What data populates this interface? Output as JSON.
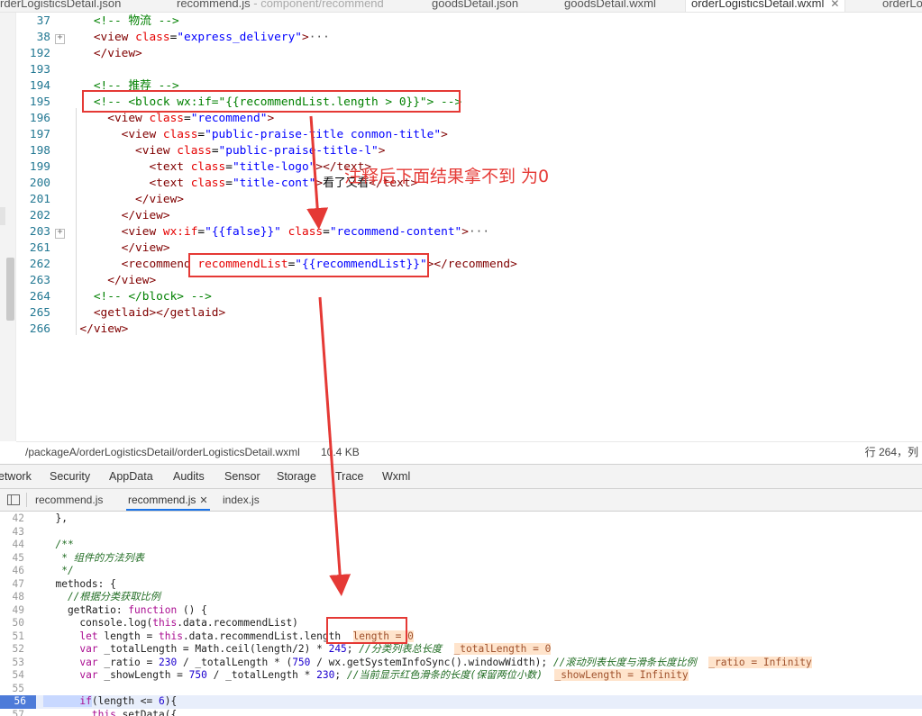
{
  "file_tabs": [
    {
      "label": "rderLogisticsDetail.json",
      "sub": ""
    },
    {
      "label": "recommend.js",
      "sub": " - component/recommend"
    },
    {
      "label": "goodsDetail.json",
      "sub": ""
    },
    {
      "label": "goodsDetail.wxml",
      "sub": ""
    },
    {
      "label": "orderLogisticsDetail.wxml",
      "sub": "",
      "close": "✕"
    },
    {
      "label": "orderLo",
      "sub": ""
    }
  ],
  "editor_lines": [
    {
      "num": "37",
      "fold": false,
      "tokens": [
        [
          "c-com",
          "<!-- 物流 -->"
        ]
      ],
      "indent": "    "
    },
    {
      "num": "38",
      "fold": true,
      "tokens": [
        [
          "c-tag",
          "<view "
        ],
        [
          "c-attr",
          "class"
        ],
        [
          "c-txt",
          "="
        ],
        [
          "c-str",
          "\"express_delivery\""
        ],
        [
          "c-tag",
          ">"
        ],
        [
          "c-ell",
          "···"
        ]
      ],
      "indent": "    "
    },
    {
      "num": "192",
      "fold": false,
      "tokens": [
        [
          "c-tag",
          "</view>"
        ]
      ],
      "indent": "    "
    },
    {
      "num": "193",
      "fold": false,
      "tokens": [],
      "indent": ""
    },
    {
      "num": "194",
      "fold": false,
      "tokens": [
        [
          "c-com",
          "<!-- 推荐 -->"
        ]
      ],
      "indent": "    "
    },
    {
      "num": "195",
      "fold": false,
      "tokens": [
        [
          "c-com",
          "<!-- <block wx:if=\"{{recommendList.length > 0}}\"> -->"
        ]
      ],
      "indent": "    "
    },
    {
      "num": "196",
      "fold": false,
      "tokens": [
        [
          "c-tag",
          "<view "
        ],
        [
          "c-attr",
          "class"
        ],
        [
          "c-txt",
          "="
        ],
        [
          "c-str",
          "\"recommend\""
        ],
        [
          "c-tag",
          ">"
        ]
      ],
      "indent": "      "
    },
    {
      "num": "197",
      "fold": false,
      "tokens": [
        [
          "c-tag",
          "<view "
        ],
        [
          "c-attr",
          "class"
        ],
        [
          "c-txt",
          "="
        ],
        [
          "c-str",
          "\"public-praise-title conmon-title\""
        ],
        [
          "c-tag",
          ">"
        ]
      ],
      "indent": "        "
    },
    {
      "num": "198",
      "fold": false,
      "tokens": [
        [
          "c-tag",
          "<view "
        ],
        [
          "c-attr",
          "class"
        ],
        [
          "c-txt",
          "="
        ],
        [
          "c-str",
          "\"public-praise-title-l\""
        ],
        [
          "c-tag",
          ">"
        ]
      ],
      "indent": "          "
    },
    {
      "num": "199",
      "fold": false,
      "tokens": [
        [
          "c-tag",
          "<text "
        ],
        [
          "c-attr",
          "class"
        ],
        [
          "c-txt",
          "="
        ],
        [
          "c-str",
          "\"title-logo\""
        ],
        [
          "c-tag",
          "></text>"
        ]
      ],
      "indent": "            "
    },
    {
      "num": "200",
      "fold": false,
      "tokens": [
        [
          "c-tag",
          "<text "
        ],
        [
          "c-attr",
          "class"
        ],
        [
          "c-txt",
          "="
        ],
        [
          "c-str",
          "\"title-cont\""
        ],
        [
          "c-tag",
          ">"
        ],
        [
          "c-txt",
          "看了又看"
        ],
        [
          "c-tag",
          "</text>"
        ]
      ],
      "indent": "            "
    },
    {
      "num": "201",
      "fold": false,
      "tokens": [
        [
          "c-tag",
          "</view>"
        ]
      ],
      "indent": "          "
    },
    {
      "num": "202",
      "fold": false,
      "tokens": [
        [
          "c-tag",
          "</view>"
        ]
      ],
      "indent": "        "
    },
    {
      "num": "203",
      "fold": true,
      "tokens": [
        [
          "c-tag",
          "<view "
        ],
        [
          "c-attr",
          "wx:if"
        ],
        [
          "c-txt",
          "="
        ],
        [
          "c-str",
          "\"{{false}}\""
        ],
        [
          "c-txt",
          " "
        ],
        [
          "c-attr",
          "class"
        ],
        [
          "c-txt",
          "="
        ],
        [
          "c-str",
          "\"recommend-content\""
        ],
        [
          "c-tag",
          ">"
        ],
        [
          "c-ell",
          "···"
        ]
      ],
      "indent": "        "
    },
    {
      "num": "261",
      "fold": false,
      "tokens": [
        [
          "c-tag",
          "</view>"
        ]
      ],
      "indent": "        "
    },
    {
      "num": "262",
      "fold": false,
      "tokens": [
        [
          "c-tag",
          "<recommend "
        ],
        [
          "c-attr",
          "recommendList"
        ],
        [
          "c-txt",
          "="
        ],
        [
          "c-str",
          "\"{{recommendList}}\""
        ],
        [
          "c-tag",
          "></recommend>"
        ]
      ],
      "indent": "        "
    },
    {
      "num": "263",
      "fold": false,
      "tokens": [
        [
          "c-tag",
          "</view>"
        ]
      ],
      "indent": "      "
    },
    {
      "num": "264",
      "fold": false,
      "tokens": [
        [
          "c-com",
          "<!-- </block> -->"
        ]
      ],
      "indent": "    "
    },
    {
      "num": "265",
      "fold": false,
      "tokens": [
        [
          "c-tag",
          "<getlaid></getlaid>"
        ]
      ],
      "indent": "    "
    },
    {
      "num": "266",
      "fold": false,
      "tokens": [
        [
          "c-tag",
          "</view>"
        ]
      ],
      "indent": "  "
    }
  ],
  "status_bar": {
    "path": "/packageA/orderLogisticsDetail/orderLogisticsDetail.wxml",
    "size": "10.4 KB",
    "position": "行 264，列"
  },
  "devtools_tabs": [
    "etwork",
    "Security",
    "AppData",
    "Audits",
    "Sensor",
    "Storage",
    "Trace",
    "Wxml"
  ],
  "source_tabs": [
    {
      "label": "recommend.js",
      "active": false
    },
    {
      "label": "recommend.js",
      "active": true,
      "close": "✕"
    },
    {
      "label": "index.js",
      "active": false
    }
  ],
  "source_lines": [
    {
      "num": "42",
      "tokens": [
        [
          "s-txt",
          "  },"
        ]
      ]
    },
    {
      "num": "43",
      "tokens": []
    },
    {
      "num": "44",
      "tokens": [
        [
          "s-com",
          "  /**"
        ]
      ]
    },
    {
      "num": "45",
      "tokens": [
        [
          "s-com",
          "   * 组件的方法列表"
        ]
      ]
    },
    {
      "num": "46",
      "tokens": [
        [
          "s-com",
          "   */"
        ]
      ]
    },
    {
      "num": "47",
      "tokens": [
        [
          "s-txt",
          "  methods: {"
        ]
      ]
    },
    {
      "num": "48",
      "tokens": [
        [
          "s-com",
          "    //根据分类获取比例"
        ]
      ]
    },
    {
      "num": "49",
      "tokens": [
        [
          "s-txt",
          "    getRatio: "
        ],
        [
          "s-kw",
          "function"
        ],
        [
          "s-txt",
          " () {"
        ]
      ]
    },
    {
      "num": "50",
      "tokens": [
        [
          "s-txt",
          "      console.log("
        ],
        [
          "s-kw",
          "this"
        ],
        [
          "s-txt",
          ".data.recommendList)"
        ]
      ]
    },
    {
      "num": "51",
      "tokens": [
        [
          "s-kw",
          "      let"
        ],
        [
          "s-txt",
          " length = "
        ],
        [
          "s-kw",
          "this"
        ],
        [
          "s-txt",
          ".data.recommendList.length  "
        ],
        [
          "s-inl",
          "length = 0"
        ]
      ]
    },
    {
      "num": "52",
      "tokens": [
        [
          "s-kw",
          "      var"
        ],
        [
          "s-txt",
          " _totalLength = Math.ceil(length/2) * "
        ],
        [
          "s-num",
          "245"
        ],
        [
          "s-txt",
          "; "
        ],
        [
          "s-com",
          "//分类列表总长度"
        ],
        [
          "s-txt",
          "  "
        ],
        [
          "s-inl",
          "_totalLength = 0"
        ]
      ]
    },
    {
      "num": "53",
      "tokens": [
        [
          "s-kw",
          "      var"
        ],
        [
          "s-txt",
          " _ratio = "
        ],
        [
          "s-num",
          "230"
        ],
        [
          "s-txt",
          " / _totalLength * ("
        ],
        [
          "s-num",
          "750"
        ],
        [
          "s-txt",
          " / wx.getSystemInfoSync().windowWidth); "
        ],
        [
          "s-com",
          "//滚动列表长度与滑条长度比例"
        ],
        [
          "s-txt",
          "  "
        ],
        [
          "s-inl",
          "_ratio = Infinity"
        ]
      ]
    },
    {
      "num": "54",
      "tokens": [
        [
          "s-kw",
          "      var"
        ],
        [
          "s-txt",
          " _showLength = "
        ],
        [
          "s-num",
          "750"
        ],
        [
          "s-txt",
          " / _totalLength * "
        ],
        [
          "s-num",
          "230"
        ],
        [
          "s-txt",
          "; "
        ],
        [
          "s-com",
          "//当前显示红色滑条的长度(保留两位小数)"
        ],
        [
          "s-txt",
          "  "
        ],
        [
          "s-inl",
          "_showLength = Infinity"
        ]
      ]
    },
    {
      "num": "55",
      "tokens": []
    },
    {
      "num": "56",
      "tokens": [
        [
          "s-sel",
          "      "
        ],
        [
          "s-kw s-sel",
          "if"
        ],
        [
          "s-txt",
          "(length <= "
        ],
        [
          "s-num",
          "6"
        ],
        [
          "s-txt",
          "){"
        ]
      ],
      "current": true
    },
    {
      "num": "57",
      "tokens": [
        [
          "s-kw",
          "        this"
        ],
        [
          "s-txt",
          ".setData({"
        ]
      ]
    }
  ],
  "annotation": {
    "text": "注释后下面结果拿不到 为0",
    "color": "#e53935"
  }
}
